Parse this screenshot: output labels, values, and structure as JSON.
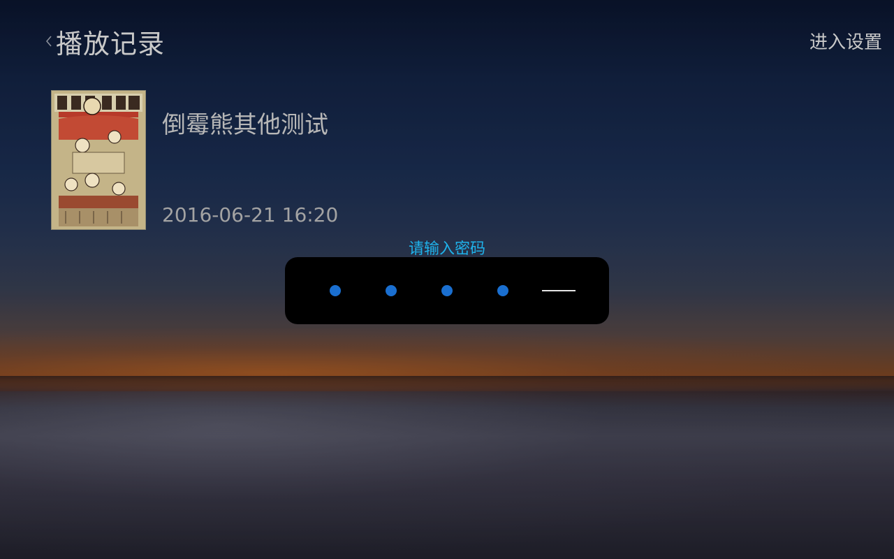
{
  "header": {
    "back_icon": "chevron-left-icon",
    "title": "播放记录",
    "settings_label": "进入设置"
  },
  "record": {
    "title": "倒霉熊其他测试",
    "time": "2016-06-21 16:20"
  },
  "password_dialog": {
    "prompt": "请输入密码",
    "digits_entered": 4,
    "digits_total": 5
  },
  "colors": {
    "prompt": "#1fb2ea",
    "dot": "#1a6fd0",
    "dialog_bg": "#000000",
    "text": "#c9c9c9"
  }
}
